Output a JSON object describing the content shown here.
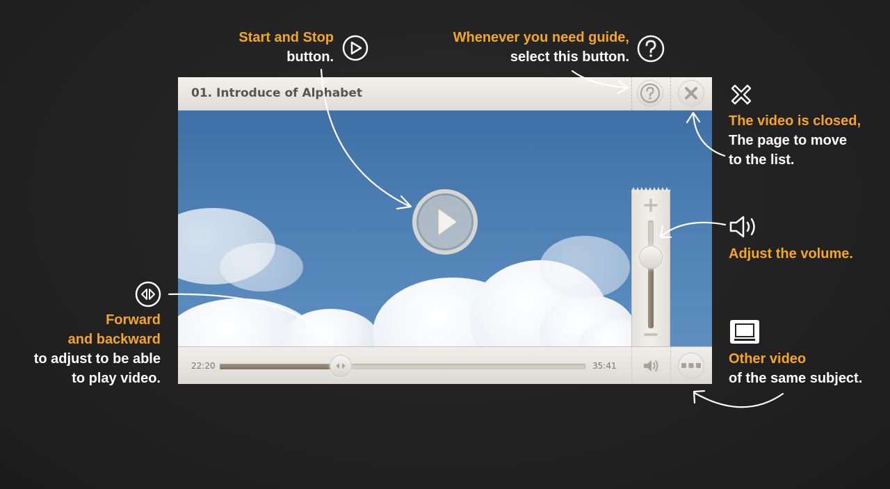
{
  "player": {
    "title": "01. Introduce of Alphabet",
    "current_time": "22:20",
    "total_time": "35:41",
    "progress_fraction": 0.33,
    "volume_fraction": 0.66
  },
  "annotations": {
    "play": {
      "line1": "Start and Stop",
      "line2": "button."
    },
    "guide": {
      "line1": "Whenever you need guide,",
      "line2": "select this button."
    },
    "close": {
      "line1": "The video is closed,",
      "line2": "The page to move",
      "line3": "to the list."
    },
    "volume": {
      "line1": "Adjust the volume."
    },
    "seek": {
      "line1": "Forward",
      "line2": "and backward",
      "line3": "to adjust to be able",
      "line4": "to play video."
    },
    "other": {
      "line1": "Other video",
      "line2": "of the same subject."
    }
  },
  "colors": {
    "accent": "#f5a623",
    "background": "#232323",
    "text": "#ffffff"
  },
  "icons": [
    "play-icon",
    "help-icon",
    "close-icon",
    "speaker-icon",
    "seek-icon",
    "list-icon",
    "more-icon"
  ]
}
